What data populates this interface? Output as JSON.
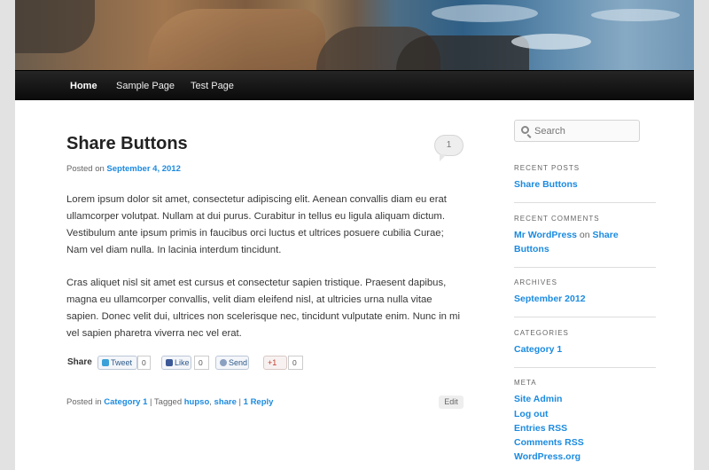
{
  "nav": {
    "home": "Home",
    "sample_page": "Sample Page",
    "test_page": "Test Page"
  },
  "post": {
    "title": "Share Buttons",
    "comment_count": "1",
    "posted_on_label": "Posted on ",
    "date": "September 4, 2012",
    "paragraphs": [
      "Lorem ipsum dolor sit amet, consectetur adipiscing elit. Aenean convallis diam eu erat ullamcorper volutpat. Nullam at dui purus. Curabitur in tellus eu ligula aliquam dictum. Vestibulum ante ipsum primis in faucibus orci luctus et ultrices posuere cubilia Curae; Nam vel diam nulla. In lacinia interdum tincidunt.",
      "Cras aliquet nisl sit amet est cursus et consectetur sapien tristique. Praesent dapibus, magna eu ullamcorper convallis, velit diam eleifend nisl, at ultricies urna nulla vitae sapien. Donec velit dui, ultrices non scelerisque nec, tincidunt vulputate enim. Nunc in mi vel sapien pharetra viverra nec vel erat."
    ],
    "share": {
      "label": "Share",
      "tweet": "Tweet",
      "tweet_count": "0",
      "like": "Like",
      "like_count": "0",
      "send": "Send",
      "gplus": "+1",
      "gplus_count": "0"
    },
    "meta": {
      "posted_in": "Posted in ",
      "category": "Category 1",
      "tagged_sep": " | Tagged ",
      "tag1": "hupso",
      "comma": ", ",
      "tag2": "share",
      "reply_sep": " | ",
      "reply": "1 Reply"
    },
    "edit_label": "Edit"
  },
  "sidebar": {
    "search_placeholder": "Search",
    "recent_posts_title": "RECENT POSTS",
    "recent_post": "Share Buttons",
    "recent_comments_title": "RECENT COMMENTS",
    "comment_author": "Mr WordPress",
    "comment_on": " on ",
    "comment_post_line1": "Share",
    "comment_post_line2": "Buttons",
    "archives_title": "ARCHIVES",
    "archive": "September 2012",
    "categories_title": "CATEGORIES",
    "category": "Category 1",
    "meta_title": "META",
    "meta_links": [
      "Site Admin",
      "Log out",
      "Entries RSS",
      "Comments RSS",
      "WordPress.org"
    ]
  },
  "colors": {
    "link": "#1b8be0",
    "nav_bg": "#111111"
  },
  "icons": [
    "search-icon",
    "twitter-icon",
    "facebook-icon",
    "send-icon",
    "google-plus-icon",
    "comment-bubble-icon"
  ]
}
